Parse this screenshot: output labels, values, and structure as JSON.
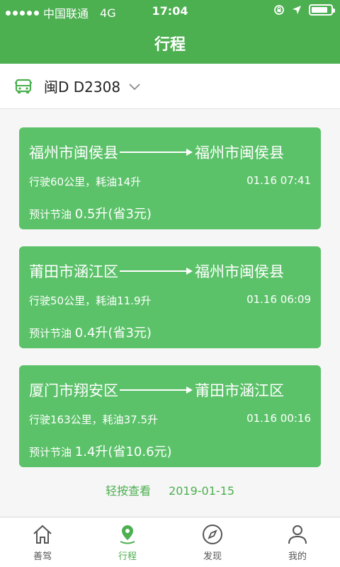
{
  "status": {
    "carrier": "中国联通",
    "network": "4G",
    "time": "17:04",
    "battery_level": 0.85
  },
  "header": {
    "title": "行程"
  },
  "vehicle": {
    "plate": "闽D D2308"
  },
  "trips": [
    {
      "from": "福州市闽侯县",
      "to": "福州市闽侯县",
      "stats": "行驶60公里，耗油14升",
      "time": "01.16 07:41",
      "save_label": "预计节油",
      "save_value": "0.5升(省3元)"
    },
    {
      "from": "莆田市涵江区",
      "to": "福州市闽侯县",
      "stats": "行驶50公里，耗油11.9升",
      "time": "01.16 06:09",
      "save_label": "预计节油",
      "save_value": "0.4升(省3元)"
    },
    {
      "from": "厦门市翔安区",
      "to": "莆田市涵江区",
      "stats": "行驶163公里，耗油37.5升",
      "time": "01.16 00:16",
      "save_label": "预计节油",
      "save_value": "1.4升(省10.6元)"
    }
  ],
  "footer": {
    "hint": "轻按查看",
    "date": "2019-01-15"
  },
  "tabs": [
    {
      "label": "善驾",
      "icon": "house-icon"
    },
    {
      "label": "行程",
      "icon": "location-pin-icon",
      "active": true
    },
    {
      "label": "发现",
      "icon": "compass-icon"
    },
    {
      "label": "我的",
      "icon": "person-icon"
    }
  ],
  "colors": {
    "accent": "#4caf50",
    "card": "#5cc26a"
  }
}
